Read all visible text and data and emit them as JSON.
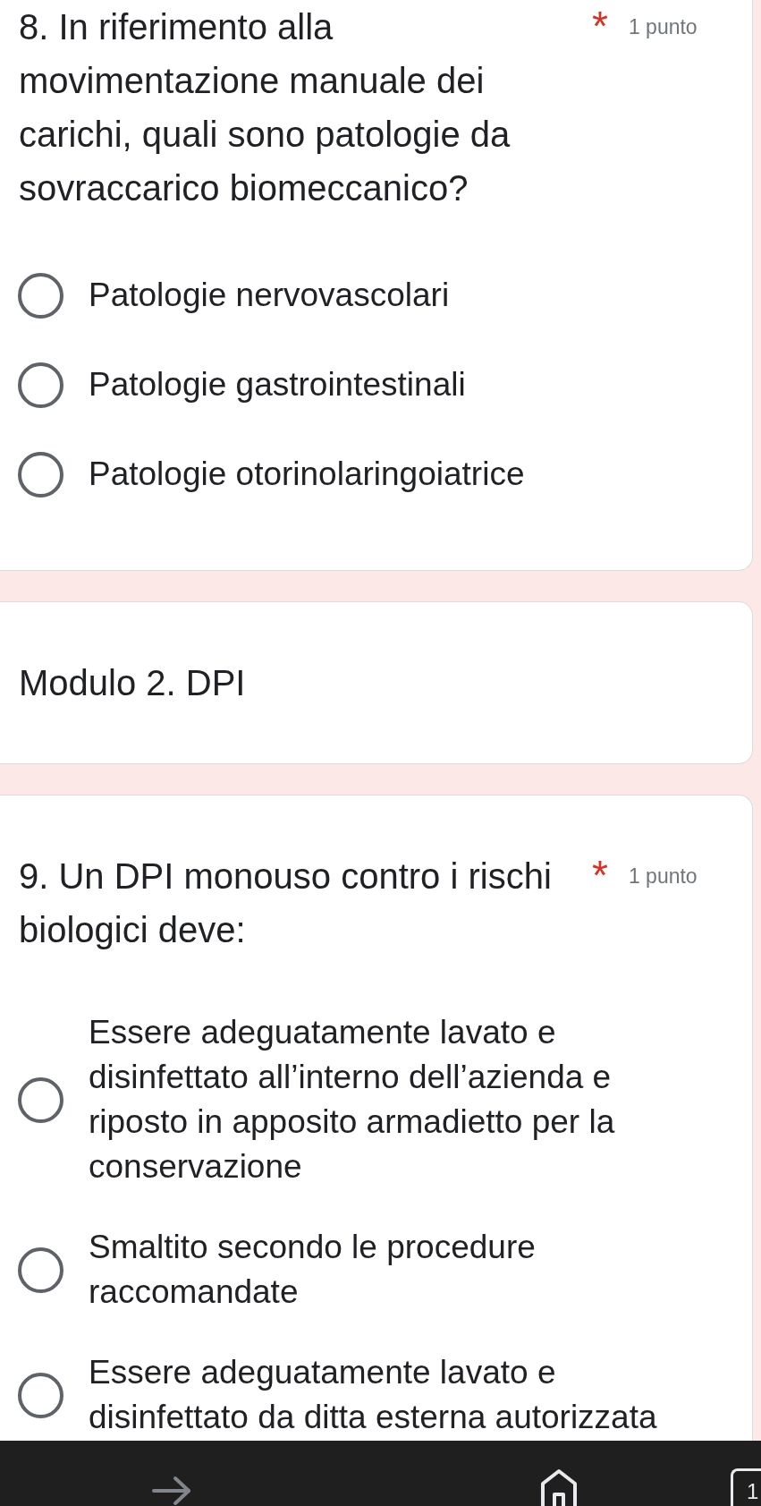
{
  "cards": [
    {
      "kind": "question",
      "title": "8. In riferimento alla movimentazione manuale dei carichi, quali sono patologie da sovraccarico biomeccanico?",
      "required_mark": "*",
      "points": "1 punto",
      "options": [
        {
          "label": "Patologie nervovascolari",
          "selected": false
        },
        {
          "label": "Patologie gastrointestinali",
          "selected": false
        },
        {
          "label": "Patologie otorinolaringoiatrice",
          "selected": false
        }
      ]
    },
    {
      "kind": "section",
      "title": "Modulo 2. DPI"
    },
    {
      "kind": "question",
      "title": "9. Un DPI monouso contro i rischi biologici deve:",
      "required_mark": "*",
      "points": "1 punto",
      "options": [
        {
          "label": "Essere adeguatamente lavato e disinfettato all’interno dell’azienda e riposto in apposito armadietto per la conservazione",
          "selected": false
        },
        {
          "label": "Smaltito secondo le procedure raccomandate",
          "selected": false
        },
        {
          "label": "Essere adeguatamente lavato e disinfettato da ditta esterna autorizzata",
          "selected": false
        }
      ]
    }
  ],
  "nav_bar": {
    "forward_disabled": true,
    "tab_count": "1"
  }
}
